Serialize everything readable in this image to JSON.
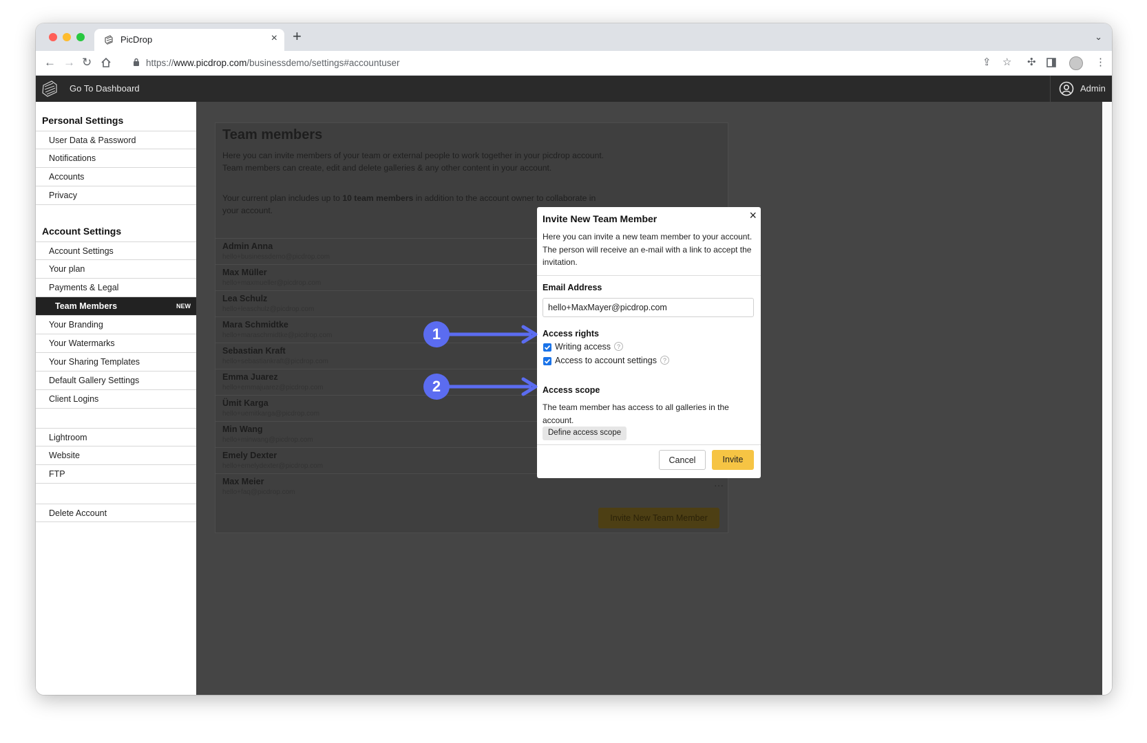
{
  "browser": {
    "tab_title": "PicDrop",
    "url_prefix": "https://",
    "url_domain": "www.picdrop.com",
    "url_path": "/businessdemo/settings#accountuser"
  },
  "header": {
    "dashboard_link": "Go To Dashboard",
    "user_label": "Admin"
  },
  "sidebar": {
    "personal_heading": "Personal Settings",
    "personal_items": [
      "User Data & Password",
      "Notifications",
      "Accounts",
      "Privacy"
    ],
    "account_heading": "Account Settings",
    "account_items": [
      "Account Settings",
      "Your plan",
      "Payments & Legal",
      "Team Members",
      "Your Branding",
      "Your Watermarks",
      "Your Sharing Templates",
      "Default Gallery Settings",
      "Client Logins"
    ],
    "active_badge": "NEW",
    "integration_items": [
      "Lightroom",
      "Website",
      "FTP"
    ],
    "delete_item": "Delete Account"
  },
  "main": {
    "title": "Team members",
    "intro": "Here you can invite members of your team or external people to work together in your picdrop account. Team members can create, edit and delete galleries & any other content in your account.",
    "plan_pre": "Your current plan includes up to ",
    "plan_bold": "10 team members",
    "plan_post": " in addition to the account owner to collaborate in your account.",
    "members": [
      {
        "name": "Admin Anna",
        "email": "hello+businessdemo@picdrop.com"
      },
      {
        "name": "Max Müller",
        "email": "hello+maxmueller@picdrop.com"
      },
      {
        "name": "Lea Schulz",
        "email": "hello+leaschulz@picdrop.com"
      },
      {
        "name": "Mara Schmidtke",
        "email": "hello+maraschmidtke@picdrop.com"
      },
      {
        "name": "Sebastian Kraft",
        "email": "hello+sebastiankraft@picdrop.com"
      },
      {
        "name": "Emma Juarez",
        "email": "hello+emmajuarez@picdrop.com"
      },
      {
        "name": "Ümit Karga",
        "email": "hello+uemitkarga@picdrop.com"
      },
      {
        "name": "Min Wang",
        "email": "hello+minwang@picdrop.com"
      },
      {
        "name": "Emely Dexter",
        "email": "hello+emelydexter@picdrop.com"
      },
      {
        "name": "Max Meier",
        "email": "hello+faq@picdrop.com"
      }
    ],
    "invite_button": "Invite New Team Member"
  },
  "modal": {
    "title": "Invite New Team Member",
    "description": "Here you can invite a new team member to your account. The person will receive an e-mail with a link to accept the invitation.",
    "email_label": "Email Address",
    "email_value": "hello+MaxMayer@picdrop.com",
    "access_rights_label": "Access rights",
    "writing_access": "Writing access",
    "settings_access": "Access to account settings",
    "access_scope_label": "Access scope",
    "scope_text": "The team member has access to all galleries in the account.",
    "define_scope_button": "Define access scope",
    "cancel_button": "Cancel",
    "invite_button": "Invite"
  },
  "annotations": {
    "marker_1": "1",
    "marker_2": "2"
  },
  "colors": {
    "accent_yellow": "#f6c444",
    "annotation_blue": "#5b6cf0",
    "header_dark": "#2a2a2a"
  }
}
